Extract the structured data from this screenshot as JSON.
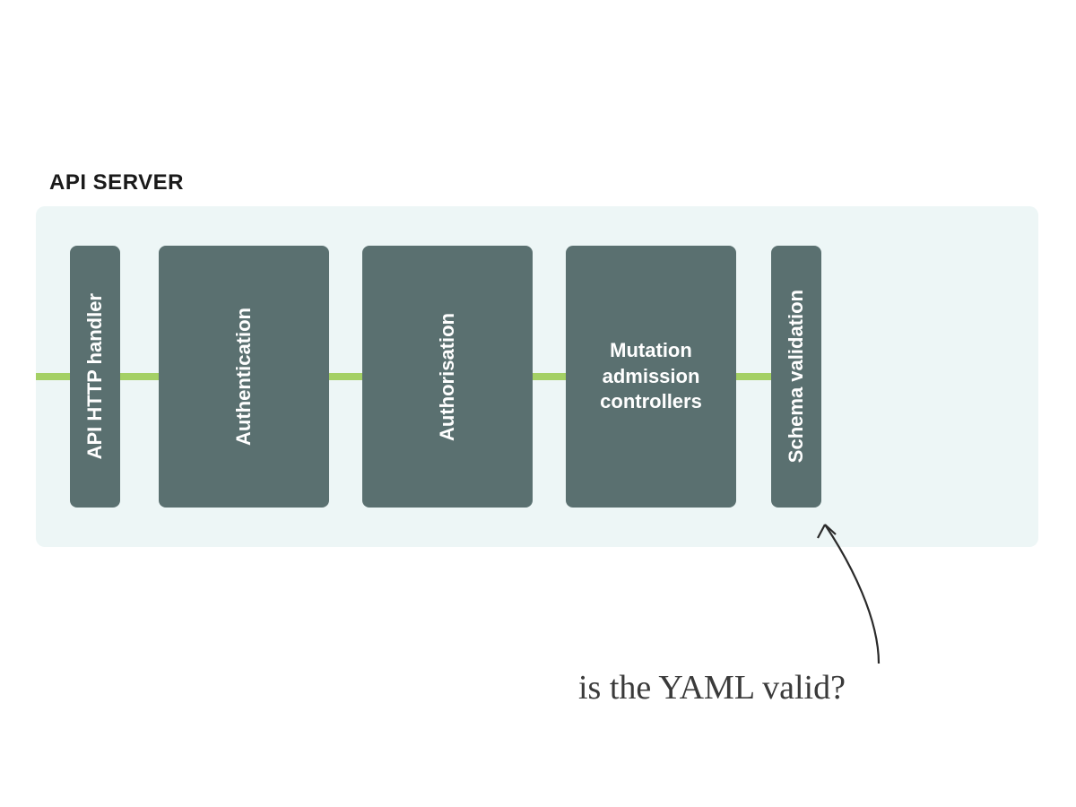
{
  "title": "API SERVER",
  "stages": [
    {
      "label": "API HTTP handler"
    },
    {
      "label": "Authentication"
    },
    {
      "label": "Authorisation"
    },
    {
      "label": "Mutation admission controllers"
    },
    {
      "label": "Schema validation"
    }
  ],
  "annotation": "is the YAML valid?",
  "colors": {
    "server_bg": "#edf6f6",
    "stage_bg": "#5a7070",
    "flow_line": "#a4d065",
    "text_on_stage": "#ffffff",
    "title_text": "#1a1a1a",
    "annotation_text": "#3a3a3a"
  }
}
